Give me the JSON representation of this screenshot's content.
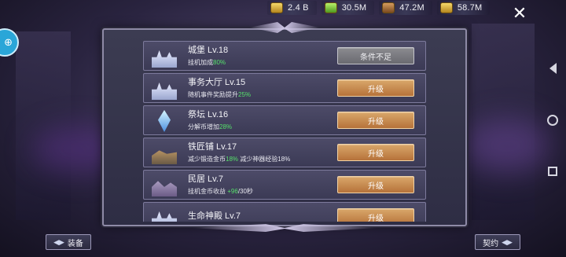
{
  "resources": [
    {
      "icon": "gold-coins-icon",
      "value": "2.4 B"
    },
    {
      "icon": "green-gem-icon",
      "value": "30.5M"
    },
    {
      "icon": "wood-chest-icon",
      "value": "47.2M"
    },
    {
      "icon": "gold-stack-icon",
      "value": "58.7M"
    }
  ],
  "close_label": "✕",
  "buildings": [
    {
      "name": "城堡 Lv.18",
      "desc": "挂机加成",
      "desc_val": "80%",
      "desc_tail": "",
      "button": "条件不足",
      "enabled": false
    },
    {
      "name": "事务大厅 Lv.15",
      "desc": "随机事件奖励提升",
      "desc_val": "25%",
      "desc_tail": "",
      "button": "升级",
      "enabled": true
    },
    {
      "name": "祭坛 Lv.16",
      "desc": "分解币增加",
      "desc_val": "28%",
      "desc_tail": "",
      "button": "升级",
      "enabled": true
    },
    {
      "name": "铁匠铺 Lv.17",
      "desc": "减少锻造金币",
      "desc_val": "18%",
      "desc_tail": " 减少神器经验18%",
      "button": "升级",
      "enabled": true
    },
    {
      "name": "民居 Lv.7",
      "desc": "挂机金币收益 ",
      "desc_val": "+96",
      "desc_tail": "/30秒",
      "button": "升级",
      "enabled": true
    },
    {
      "name": "生命神殿 Lv.7",
      "desc": "",
      "desc_val": "",
      "desc_tail": "",
      "button": "升级",
      "enabled": true
    }
  ],
  "bottom": {
    "equip_label": "装备",
    "contract_label": "契约"
  }
}
